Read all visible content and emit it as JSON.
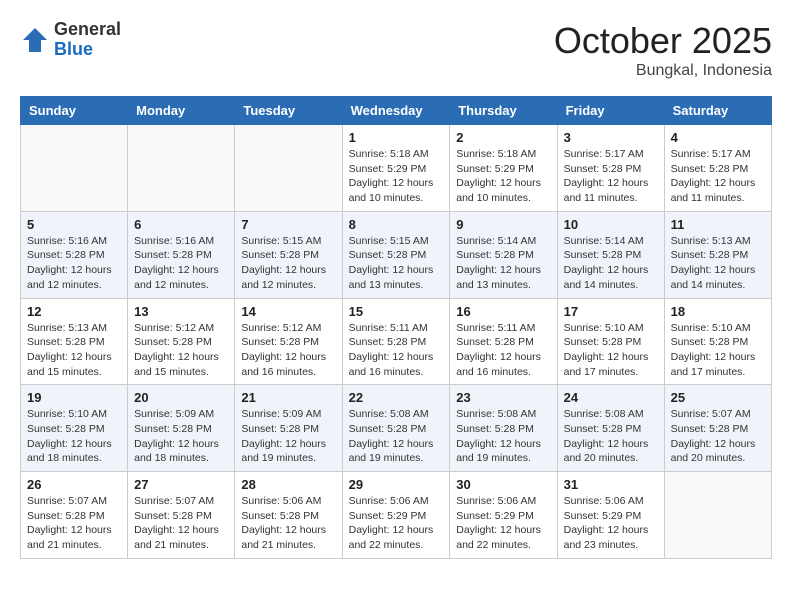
{
  "header": {
    "logo_general": "General",
    "logo_blue": "Blue",
    "month_title": "October 2025",
    "location": "Bungkal, Indonesia"
  },
  "weekdays": [
    "Sunday",
    "Monday",
    "Tuesday",
    "Wednesday",
    "Thursday",
    "Friday",
    "Saturday"
  ],
  "weeks": [
    [
      {
        "day": "",
        "info": ""
      },
      {
        "day": "",
        "info": ""
      },
      {
        "day": "",
        "info": ""
      },
      {
        "day": "1",
        "info": "Sunrise: 5:18 AM\nSunset: 5:29 PM\nDaylight: 12 hours\nand 10 minutes."
      },
      {
        "day": "2",
        "info": "Sunrise: 5:18 AM\nSunset: 5:29 PM\nDaylight: 12 hours\nand 10 minutes."
      },
      {
        "day": "3",
        "info": "Sunrise: 5:17 AM\nSunset: 5:28 PM\nDaylight: 12 hours\nand 11 minutes."
      },
      {
        "day": "4",
        "info": "Sunrise: 5:17 AM\nSunset: 5:28 PM\nDaylight: 12 hours\nand 11 minutes."
      }
    ],
    [
      {
        "day": "5",
        "info": "Sunrise: 5:16 AM\nSunset: 5:28 PM\nDaylight: 12 hours\nand 12 minutes."
      },
      {
        "day": "6",
        "info": "Sunrise: 5:16 AM\nSunset: 5:28 PM\nDaylight: 12 hours\nand 12 minutes."
      },
      {
        "day": "7",
        "info": "Sunrise: 5:15 AM\nSunset: 5:28 PM\nDaylight: 12 hours\nand 12 minutes."
      },
      {
        "day": "8",
        "info": "Sunrise: 5:15 AM\nSunset: 5:28 PM\nDaylight: 12 hours\nand 13 minutes."
      },
      {
        "day": "9",
        "info": "Sunrise: 5:14 AM\nSunset: 5:28 PM\nDaylight: 12 hours\nand 13 minutes."
      },
      {
        "day": "10",
        "info": "Sunrise: 5:14 AM\nSunset: 5:28 PM\nDaylight: 12 hours\nand 14 minutes."
      },
      {
        "day": "11",
        "info": "Sunrise: 5:13 AM\nSunset: 5:28 PM\nDaylight: 12 hours\nand 14 minutes."
      }
    ],
    [
      {
        "day": "12",
        "info": "Sunrise: 5:13 AM\nSunset: 5:28 PM\nDaylight: 12 hours\nand 15 minutes."
      },
      {
        "day": "13",
        "info": "Sunrise: 5:12 AM\nSunset: 5:28 PM\nDaylight: 12 hours\nand 15 minutes."
      },
      {
        "day": "14",
        "info": "Sunrise: 5:12 AM\nSunset: 5:28 PM\nDaylight: 12 hours\nand 16 minutes."
      },
      {
        "day": "15",
        "info": "Sunrise: 5:11 AM\nSunset: 5:28 PM\nDaylight: 12 hours\nand 16 minutes."
      },
      {
        "day": "16",
        "info": "Sunrise: 5:11 AM\nSunset: 5:28 PM\nDaylight: 12 hours\nand 16 minutes."
      },
      {
        "day": "17",
        "info": "Sunrise: 5:10 AM\nSunset: 5:28 PM\nDaylight: 12 hours\nand 17 minutes."
      },
      {
        "day": "18",
        "info": "Sunrise: 5:10 AM\nSunset: 5:28 PM\nDaylight: 12 hours\nand 17 minutes."
      }
    ],
    [
      {
        "day": "19",
        "info": "Sunrise: 5:10 AM\nSunset: 5:28 PM\nDaylight: 12 hours\nand 18 minutes."
      },
      {
        "day": "20",
        "info": "Sunrise: 5:09 AM\nSunset: 5:28 PM\nDaylight: 12 hours\nand 18 minutes."
      },
      {
        "day": "21",
        "info": "Sunrise: 5:09 AM\nSunset: 5:28 PM\nDaylight: 12 hours\nand 19 minutes."
      },
      {
        "day": "22",
        "info": "Sunrise: 5:08 AM\nSunset: 5:28 PM\nDaylight: 12 hours\nand 19 minutes."
      },
      {
        "day": "23",
        "info": "Sunrise: 5:08 AM\nSunset: 5:28 PM\nDaylight: 12 hours\nand 19 minutes."
      },
      {
        "day": "24",
        "info": "Sunrise: 5:08 AM\nSunset: 5:28 PM\nDaylight: 12 hours\nand 20 minutes."
      },
      {
        "day": "25",
        "info": "Sunrise: 5:07 AM\nSunset: 5:28 PM\nDaylight: 12 hours\nand 20 minutes."
      }
    ],
    [
      {
        "day": "26",
        "info": "Sunrise: 5:07 AM\nSunset: 5:28 PM\nDaylight: 12 hours\nand 21 minutes."
      },
      {
        "day": "27",
        "info": "Sunrise: 5:07 AM\nSunset: 5:28 PM\nDaylight: 12 hours\nand 21 minutes."
      },
      {
        "day": "28",
        "info": "Sunrise: 5:06 AM\nSunset: 5:28 PM\nDaylight: 12 hours\nand 21 minutes."
      },
      {
        "day": "29",
        "info": "Sunrise: 5:06 AM\nSunset: 5:29 PM\nDaylight: 12 hours\nand 22 minutes."
      },
      {
        "day": "30",
        "info": "Sunrise: 5:06 AM\nSunset: 5:29 PM\nDaylight: 12 hours\nand 22 minutes."
      },
      {
        "day": "31",
        "info": "Sunrise: 5:06 AM\nSunset: 5:29 PM\nDaylight: 12 hours\nand 23 minutes."
      },
      {
        "day": "",
        "info": ""
      }
    ]
  ]
}
